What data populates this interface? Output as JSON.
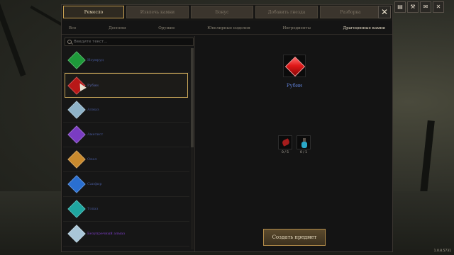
{
  "tabs": [
    "Ремесло",
    "Извлечь камни",
    "Бонус",
    "Добавить гнезда",
    "Разборка"
  ],
  "categories": [
    "Все",
    "Доспехи",
    "Оружие",
    "Ювелирные изделия",
    "Ингредиенты",
    "Драгоценные камни"
  ],
  "search": {
    "placeholder": "Введите текст..."
  },
  "items": [
    {
      "label": "Изумруд",
      "color": "#1e9a3a"
    },
    {
      "label": "Рубин",
      "color": "#b81818"
    },
    {
      "label": "Алмаз",
      "color": "#8fb3c8"
    },
    {
      "label": "Аметист",
      "color": "#7a3cc2"
    },
    {
      "label": "Опал",
      "color": "#c98a2e"
    },
    {
      "label": "Сапфир",
      "color": "#2a6fd0"
    },
    {
      "label": "Топаз",
      "color": "#1fa6a0"
    },
    {
      "label": "Безупречный алмаз",
      "color": "#a9c6d8"
    }
  ],
  "detail": {
    "title": "Рубин",
    "ingredients": [
      {
        "icon": "red-gem-shard-icon",
        "count": "0 / 5"
      },
      {
        "icon": "blue-potion-icon",
        "count": "0 / 1"
      }
    ],
    "craft_label": "Создать предмет"
  },
  "top_icons": [
    "book-icon",
    "anvil-icon",
    "mail-icon",
    "close-icon"
  ],
  "version": "1.0.8.5731"
}
